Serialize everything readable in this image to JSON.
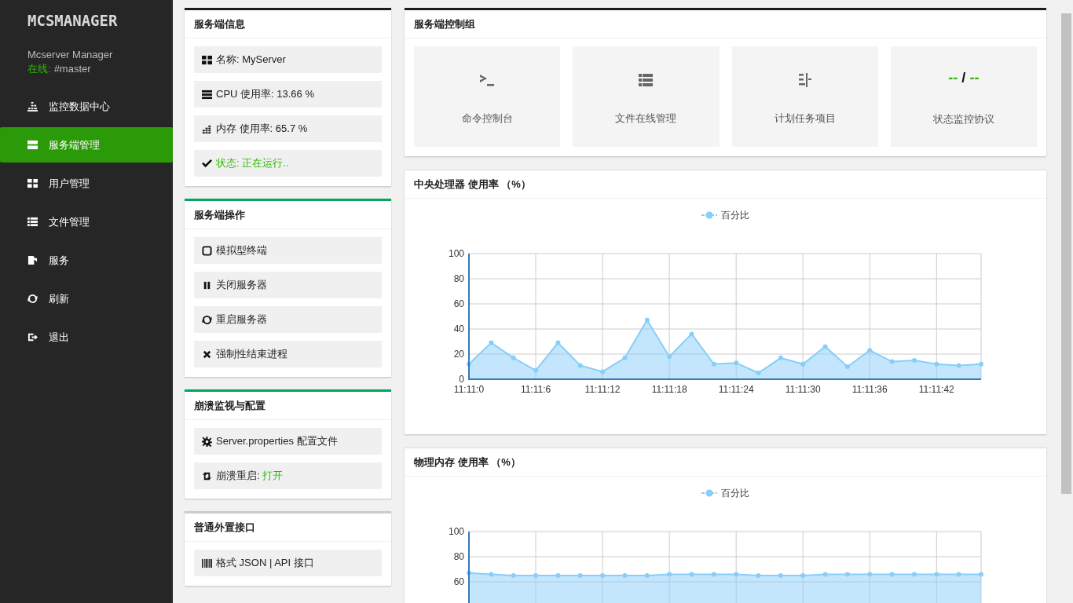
{
  "sidebar": {
    "logo": "MCSMANAGER",
    "user": {
      "name": "Mcserver Manager",
      "status_label": "在线:",
      "online": true,
      "status_value": "#master"
    },
    "items": [
      {
        "kind": "bars",
        "label": "监控数据中心",
        "selected": false
      },
      {
        "kind": "server",
        "label": "服务端管理",
        "selected": true
      },
      {
        "kind": "grid",
        "label": "用户管理",
        "selected": false
      },
      {
        "kind": "list",
        "label": "文件管理",
        "selected": false
      },
      {
        "kind": "flag",
        "label": "服务",
        "selected": false
      },
      {
        "kind": "refresh",
        "label": "刷新",
        "selected": false
      },
      {
        "kind": "logout",
        "label": "退出",
        "selected": false
      }
    ]
  },
  "left_cards": [
    {
      "title": "服务端信息",
      "color": "#1c1c1c",
      "items": [
        {
          "kind": "grid",
          "text": "名称: MyServer"
        },
        {
          "kind": "server",
          "text": "CPU 使用率: 13.66 %"
        },
        {
          "kind": "bars",
          "text": "内存 使用率: 65.7 %"
        },
        {
          "kind": "check",
          "text": "状态: 正在运行..",
          "running": true
        }
      ]
    },
    {
      "title": "服务端操作",
      "color": "#00a65a",
      "items": [
        {
          "kind": "square",
          "text": "模拟型终端"
        },
        {
          "kind": "pause",
          "text": "关闭服务器"
        },
        {
          "kind": "refresh",
          "text": "重启服务器"
        },
        {
          "kind": "times",
          "text": "强制性结束进程"
        }
      ]
    },
    {
      "title": "崩溃监视与配置",
      "color": "#00a65a",
      "items": [
        {
          "kind": "cog",
          "text": "Server.properties 配置文件"
        },
        {
          "kind": "retweet",
          "text": "崩溃重启:",
          "value": "打开",
          "enabled": true
        }
      ]
    },
    {
      "title": "普通外置接口",
      "color": "#cccccc",
      "items": [
        {
          "kind": "barcode",
          "text": "格式 JSON | API 接口"
        }
      ]
    }
  ],
  "control_group": {
    "title": "服务端控制组",
    "tiles": [
      {
        "kind": "terminal",
        "label": "命令控制台"
      },
      {
        "kind": "list",
        "label": "文件在线管理"
      },
      {
        "kind": "tasks",
        "label": "计划任务项目"
      },
      {
        "kind": "reading",
        "reading": [
          "--",
          "/",
          "--"
        ],
        "label": "状态监控协议"
      }
    ]
  },
  "charts": [
    {
      "title": "中央处理器 使用率 （%）",
      "chart_data": {
        "type": "area",
        "grid": true,
        "categories": [
          "11:11:0",
          null,
          null,
          "11:11:6",
          null,
          null,
          "11:11:12",
          null,
          null,
          "11:11:18",
          null,
          null,
          "11:11:24",
          null,
          null,
          "11:11:30",
          null,
          null,
          "11:11:36",
          null,
          null,
          "11:11:42",
          null,
          null
        ],
        "ylim": [
          0,
          100
        ],
        "yticks": [
          0,
          20,
          40,
          60,
          80,
          100
        ],
        "series": [
          {
            "name": "百分比",
            "color": "#87cefa",
            "values": [
              12,
              29,
              17,
              7,
              29,
              11,
              6,
              17,
              47,
              18,
              36,
              12,
              13,
              5,
              17,
              12,
              26,
              10,
              23,
              14,
              15,
              12,
              11,
              12
            ]
          }
        ]
      }
    },
    {
      "title": "物理内存 使用率 （%）",
      "chart_data": {
        "type": "area",
        "grid": true,
        "ylim": [
          0,
          100
        ],
        "yticks": [
          60,
          80,
          100
        ],
        "series": [
          {
            "name": "百分比",
            "color": "#87cefa",
            "values": [
              67,
              66,
              65,
              65,
              65,
              65,
              65,
              65,
              65,
              66,
              66,
              66,
              66,
              65,
              65,
              65,
              66,
              66,
              66,
              66,
              66,
              66,
              66,
              66
            ]
          }
        ]
      }
    }
  ]
}
